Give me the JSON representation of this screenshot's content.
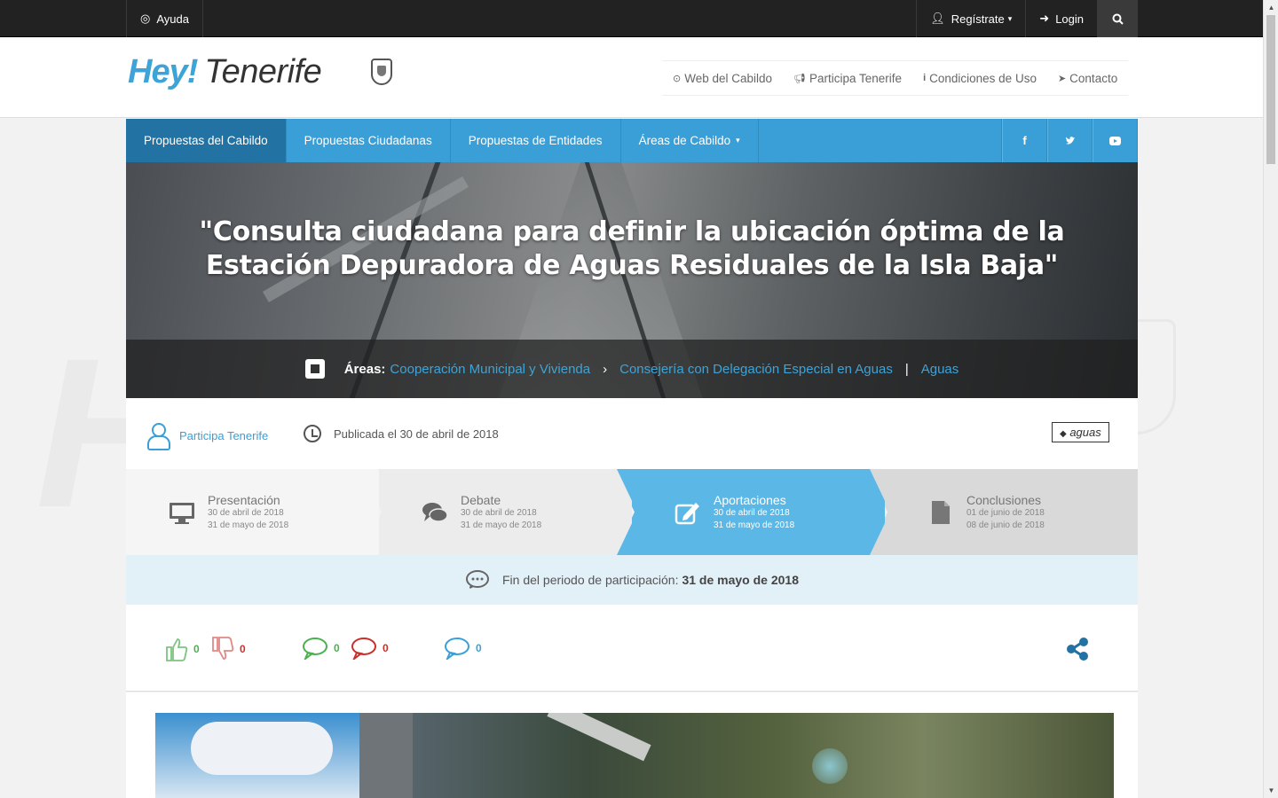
{
  "topbar": {
    "help": "Ayuda",
    "register": "Regístrate",
    "login": "Login"
  },
  "header": {
    "logo_hey": "Hey!",
    "logo_tenerife": "Tenerife",
    "nav": [
      "Web del Cabildo",
      "Participa Tenerife",
      "Condiciones de Uso",
      "Contacto"
    ]
  },
  "mainnav": {
    "items": [
      "Propuestas del Cabildo",
      "Propuestas Ciudadanas",
      "Propuestas de Entidades",
      "Áreas de Cabildo"
    ],
    "social_icons": [
      "facebook-icon",
      "twitter-icon",
      "youtube-icon"
    ]
  },
  "hero": {
    "title": "\"Consulta ciudadana para definir la ubicación óptima de la Estación Depuradora de Aguas Residuales de la Isla Baja\"",
    "areas_label": "Áreas:",
    "area1": "Cooperación Municipal y Vivienda",
    "area2": "Consejería con Delegación Especial en Aguas",
    "area3": "Aguas"
  },
  "meta": {
    "author": "Participa Tenerife",
    "published": "Publicada el 30 de abril de 2018",
    "tag": "aguas"
  },
  "phases": [
    {
      "title": "Presentación",
      "start": "30 de abril de 2018",
      "end": "31 de mayo de 2018"
    },
    {
      "title": "Debate",
      "start": "30 de abril de 2018",
      "end": "31 de mayo de 2018"
    },
    {
      "title": "Aportaciones",
      "start": "30 de abril de 2018",
      "end": "31 de mayo de 2018"
    },
    {
      "title": "Conclusiones",
      "start": "01 de junio de 2018",
      "end": "08 de junio de 2018"
    }
  ],
  "endbar": {
    "label": "Fin del periodo de participación:",
    "date": "31 de mayo de 2018"
  },
  "votes": {
    "likes": "0",
    "dislikes": "0",
    "positive_comments": "0",
    "negative_comments": "0",
    "neutral_comments": "0"
  },
  "colors": {
    "accent": "#3a9fd6",
    "active_nav": "#2272a3",
    "active_phase": "#5bb8e6",
    "topbar": "#222222"
  }
}
